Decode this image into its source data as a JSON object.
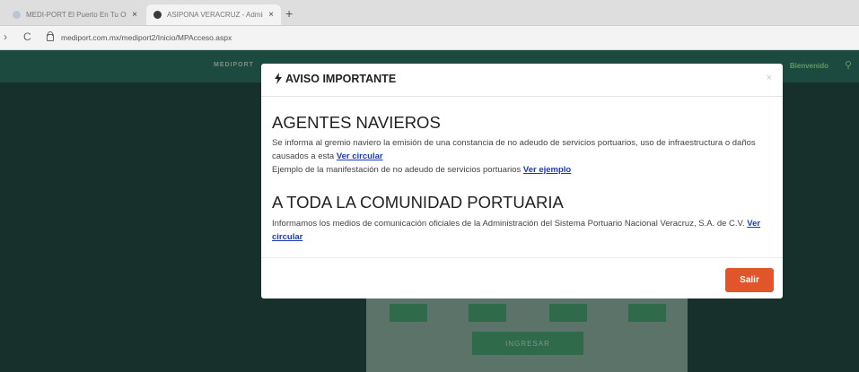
{
  "browser": {
    "tabs": [
      {
        "title": "MEDI-PORT El Puerto En Tu Oficina",
        "close": "×"
      },
      {
        "title": "ASIPONA VERACRUZ - Administración",
        "close": "×"
      }
    ],
    "new_tab": "+",
    "url": "mediport.com.mx/mediport2/Inicio/MPAcceso.aspx",
    "nav_back": "›",
    "nav_reload": "C"
  },
  "site": {
    "logo_text": "MEDIPORT",
    "header_right": "Bienvenido",
    "ingresar": "INGRESAR"
  },
  "modal": {
    "title": "AVISO IMPORTANTE",
    "close": "×",
    "section1": {
      "heading": "AGENTES NAVIEROS",
      "line1_text": "Se informa al gremio naviero la emisión de una constancia de no adeudo de servicios portuarios, uso de infraestructura o daños causados a esta ",
      "line1_link": "Ver circular",
      "line2_text": "Ejemplo de la manifestación de no adeudo de servicios portuarios ",
      "line2_link": "Ver ejemplo"
    },
    "section2": {
      "heading": "A TODA LA COMUNIDAD PORTUARIA",
      "line_text": "Informamos los medios de comunicación oficiales de la Administración del Sistema Portuario Nacional Veracruz, S.A. de C.V. ",
      "line_link": "Ver circular"
    },
    "exit_button": "Salir"
  },
  "colors": {
    "accent_button": "#e0552a",
    "link": "#1a3bb8",
    "page_bg": "#17302b"
  },
  "icons": [
    "lightning-bolt-icon",
    "lock-icon",
    "close-icon",
    "search-icon",
    "reload-icon"
  ]
}
